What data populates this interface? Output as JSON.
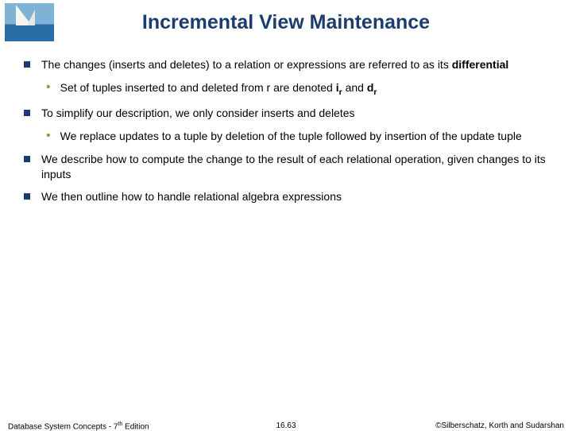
{
  "title": "Incremental View Maintenance",
  "bullets": {
    "b1a": "The changes (inserts and deletes) to a relation or expressions are referred to as its ",
    "b1bold": "differential",
    "s1a": "Set of tuples inserted to and deleted from r are denoted ",
    "s1b": "i",
    "s1sub1": "r",
    "s1c": " and ",
    "s1d": "d",
    "s1sub2": "r",
    "b2": "To simplify our description, we only consider inserts and deletes",
    "s2": "We replace updates to a tuple by deletion of the tuple followed by insertion of the update tuple",
    "b3": "We describe how to compute the change to the result of each relational operation, given changes to its inputs",
    "b4": "We then outline how to handle relational algebra expressions"
  },
  "footer": {
    "left_a": "Database System Concepts - 7",
    "left_sup": "th",
    "left_b": " Edition",
    "center": "16.63",
    "right": "©Silberschatz, Korth and Sudarshan"
  }
}
